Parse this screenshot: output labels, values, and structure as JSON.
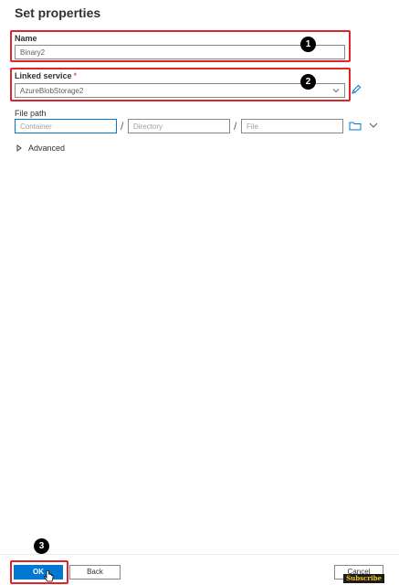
{
  "panel": {
    "title": "Set properties"
  },
  "name_field": {
    "label": "Name",
    "value": "Binary2"
  },
  "linked_service": {
    "label": "Linked service",
    "required_mark": "*",
    "value": "AzureBlobStorage2"
  },
  "file_path": {
    "label": "File path",
    "container_placeholder": "Container",
    "directory_placeholder": "Directory",
    "file_placeholder": "File",
    "separator": "/"
  },
  "advanced": {
    "label": "Advanced"
  },
  "annotations": {
    "badge1": "1",
    "badge2": "2",
    "badge3": "3",
    "highlight_color": "#e3232a"
  },
  "footer": {
    "ok_label": "OK",
    "back_label": "Back",
    "cancel_label": "Cancel"
  },
  "watermark": {
    "label": "Subscribe"
  },
  "icons": {
    "edit": "pencil-icon",
    "browse": "folder-icon",
    "expand": "chevron-down-icon",
    "dropdown": "chevron-down-icon",
    "advanced": "triangle-right-icon",
    "cursor": "hand-pointer-icon"
  },
  "colors": {
    "accent": "#0078d4",
    "annotation": "#e3232a"
  }
}
